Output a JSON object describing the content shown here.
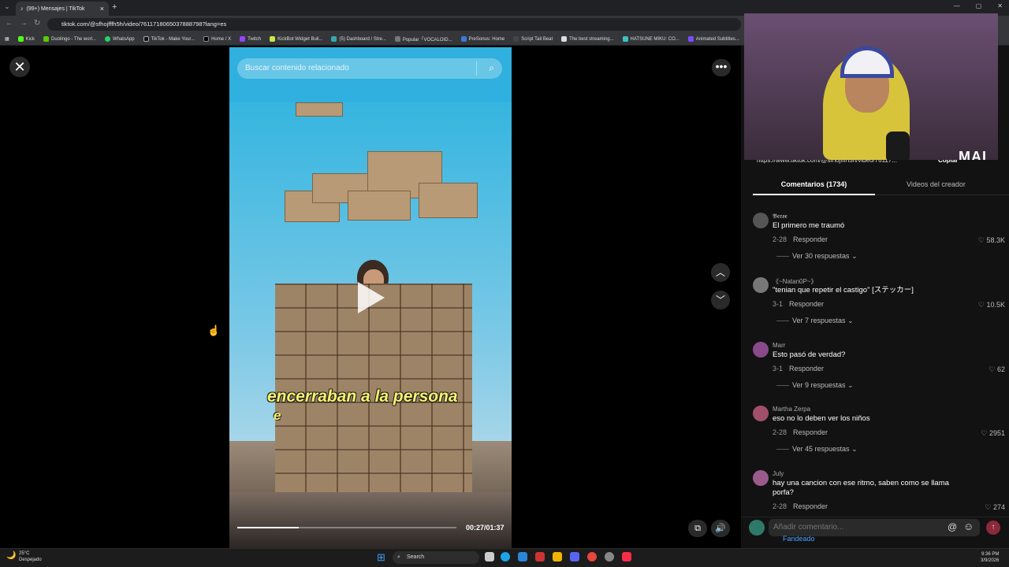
{
  "browser": {
    "tab_title": "(99+) Mensajes | TikTok",
    "tab_close": "×",
    "new_tab": "+",
    "url": "tiktok.com/@sfhojfffh5h/video/7611718065037888798?lang=es",
    "bookmarks": [
      "Kick",
      "Duolingo - The worl...",
      "WhatsApp",
      "TikTok - Make Your...",
      "Home / X",
      "Twitch",
      "KickBot Widget Buil...",
      "(5) Dashboard / Stre...",
      "Popular「VOCALOID...",
      "PreSonus: Home",
      "Script Tail Beat",
      "The best streaming...",
      "HATSUNE MIKU: CO...",
      "Animated Subtitles..."
    ]
  },
  "video": {
    "search_placeholder": "Buscar contenido relacionado",
    "caption_line1": "encerraban a la persona",
    "caption_line2": "e",
    "time": "00:27/01:37",
    "progress_fraction": 0.28
  },
  "stream_overlay": {
    "logo": "MAI",
    "share_url": "https://www.tiktok.com/@sfhojfffh5h/video/76117...",
    "copy_label": "Copiar"
  },
  "panel": {
    "tab_comments": "Comentarios (1734)",
    "tab_creator_videos": "Videos del creador",
    "comments": [
      {
        "user": "𝕭𝖊𝖗𝖔𝖊",
        "text": "El primero me traumó",
        "date": "2-28",
        "reply": "Responder",
        "likes": "58.3K",
        "more": "Ver 30 respuestas",
        "avatar_color": "#555555"
      },
      {
        "user": "《~Natan0P~》",
        "text": "\"tenian que repetir el castigo\" [ステッカー]",
        "date": "3-1",
        "reply": "Responder",
        "likes": "10.5K",
        "more": "Ver 7 respuestas",
        "avatar_color": "#777777"
      },
      {
        "user": "Marr",
        "text": "Esto pasó de verdad?",
        "date": "3-1",
        "reply": "Responder",
        "likes": "62",
        "more": "Ver 9 respuestas",
        "avatar_color": "#8a4a8a"
      },
      {
        "user": "Martha Zerpa",
        "text": "eso no lo deben ver los niños",
        "date": "2-28",
        "reply": "Responder",
        "likes": "2951",
        "more": "Ver 45 respuestas",
        "avatar_color": "#a0506a"
      },
      {
        "user": "July",
        "text": "hay una cancion con ese ritmo, saben como se llama porfa?",
        "date": "2-28",
        "reply": "Responder",
        "likes": "274",
        "more": "",
        "avatar_color": "#9a5a8a"
      }
    ],
    "comment_placeholder": "Añadir comentario...",
    "fandeado": "Fandeado"
  },
  "taskbar": {
    "weather_temp": "25°C",
    "weather_desc": "Despejado",
    "search_label": "Search",
    "time": "9:36 PM",
    "date": "3/9/2026"
  }
}
